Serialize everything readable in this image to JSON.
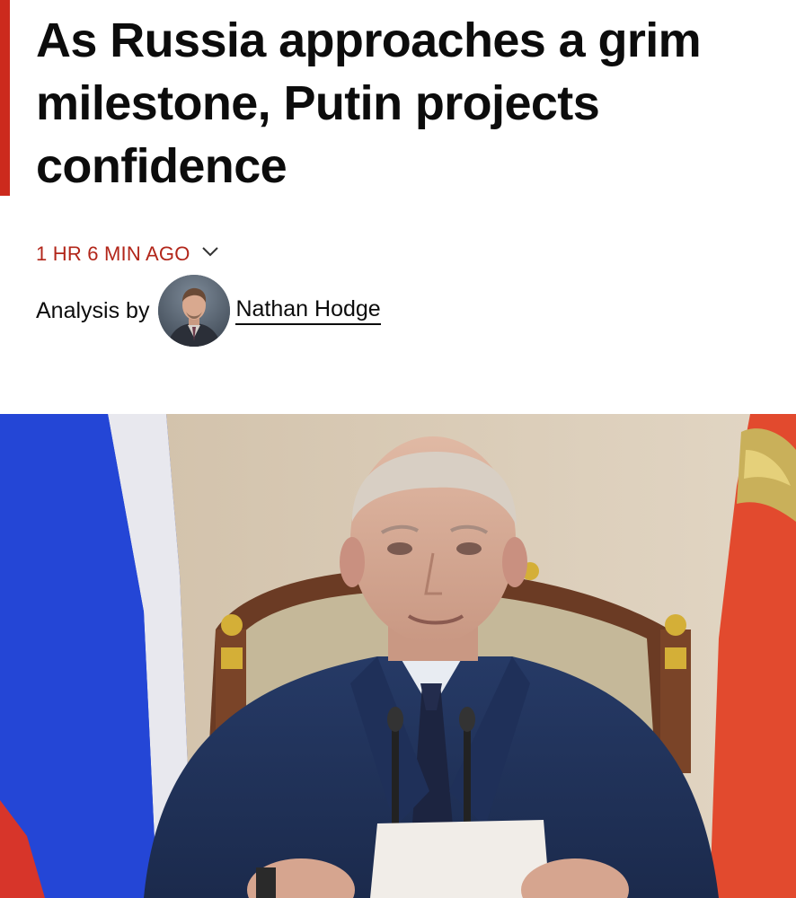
{
  "article": {
    "headline": "As Russia approaches a grim milestone, Putin projects confidence",
    "timestamp": "1 HR 6 MIN AGO",
    "byline_prefix": "Analysis by",
    "author_name": "Nathan Hodge"
  },
  "icons": {
    "timestamp_toggle": "chevron-down-icon"
  },
  "colors": {
    "accent": "#cc2a1d",
    "timestamp": "#b2261a",
    "text": "#0c0c0c"
  }
}
